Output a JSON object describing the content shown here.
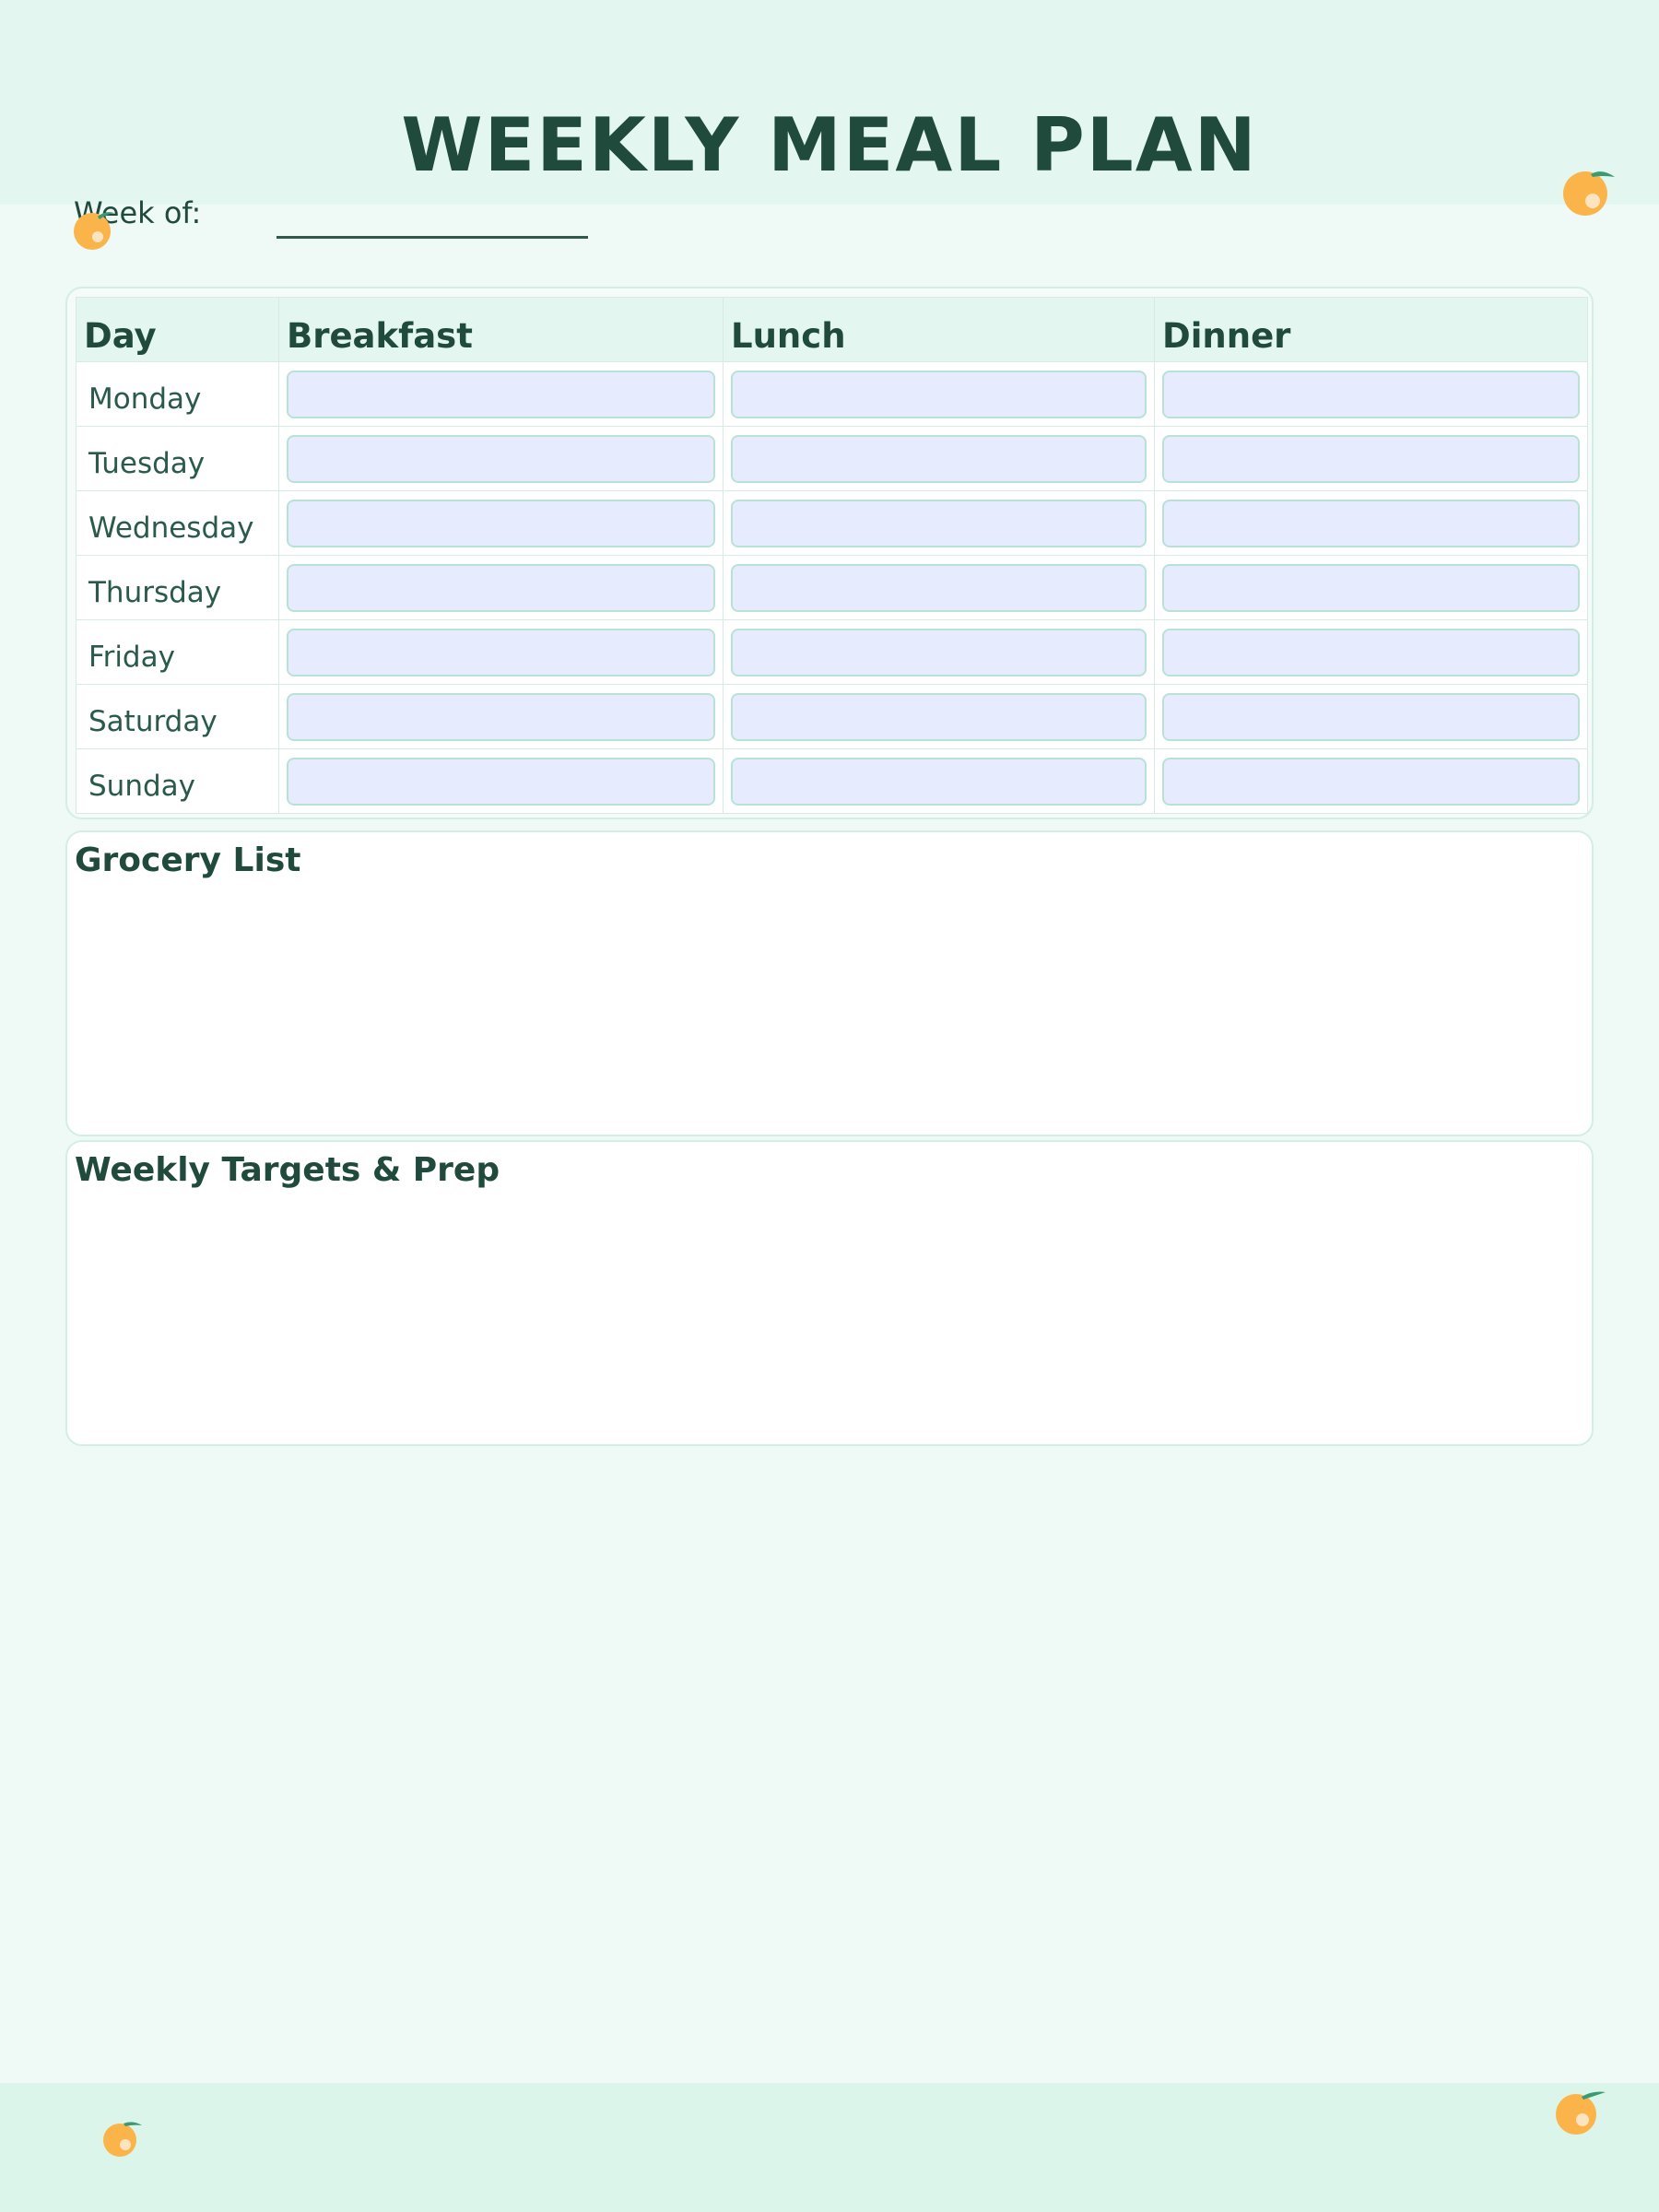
{
  "header": {
    "title": "WEEKLY MEAL PLAN",
    "week_label": "Week of:"
  },
  "table": {
    "columns": [
      "Day",
      "Breakfast",
      "Lunch",
      "Dinner"
    ],
    "days": [
      "Monday",
      "Tuesday",
      "Wednesday",
      "Thursday",
      "Friday",
      "Saturday",
      "Sunday"
    ]
  },
  "sections": {
    "grocery_title": "Grocery List",
    "targets_title": "Weekly Targets & Prep"
  },
  "colors": {
    "accent": "#1f4a3c",
    "orange": "#fbb44a",
    "leaf": "#3a9a72",
    "input_fill": "#e6ecfd"
  }
}
